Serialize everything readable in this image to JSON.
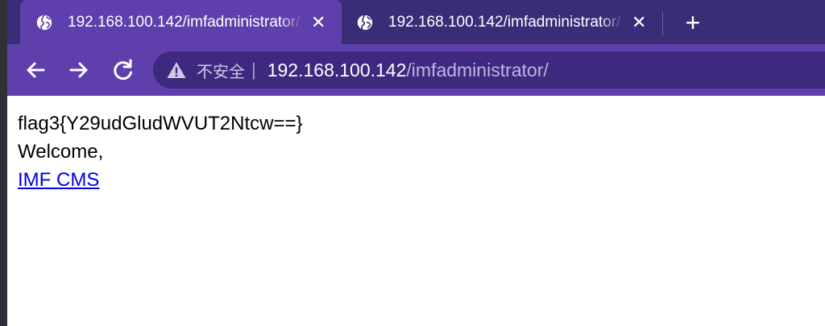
{
  "tabs": [
    {
      "title": "192.168.100.142/imfadministrator/",
      "close": "✕",
      "active": true
    },
    {
      "title": "192.168.100.142/imfadministrator/",
      "close": "✕",
      "active": false
    }
  ],
  "new_tab_label": "+",
  "toolbar": {
    "back": "←",
    "forward": "→",
    "reload": "C"
  },
  "omnibox": {
    "security_label": "不安全",
    "separator": "|",
    "url_host": "192.168.100.142",
    "url_path": "/imfadministrator/"
  },
  "page": {
    "flag_line": "flag3{Y29udGludWVUT2Ntcw==}",
    "welcome": "Welcome,",
    "link_text": "IMF CMS"
  },
  "icons": {
    "tab_favicon": "globe-icon",
    "security": "warning-triangle-icon"
  },
  "colors": {
    "tabbar_bg": "#3a2d78",
    "active_tab": "#5e3fac",
    "omnibox_bg": "#3d2a7e",
    "link": "#0000ee"
  }
}
